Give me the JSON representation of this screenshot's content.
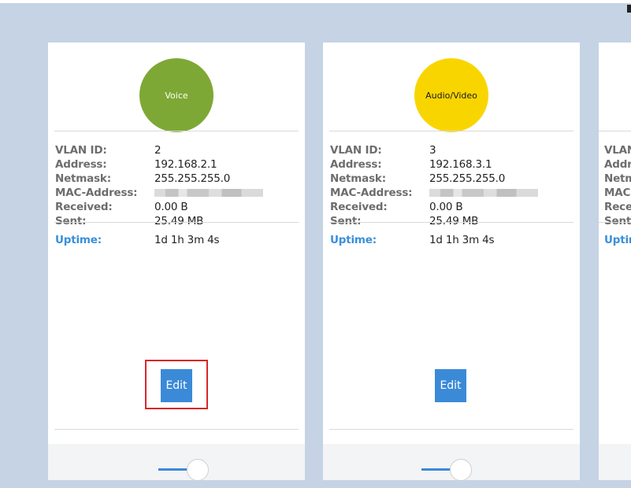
{
  "colors": {
    "voice": "#7ea835",
    "audio_video": "#f9d500",
    "accent": "#3b8ad8",
    "highlight": "#d9262a"
  },
  "labels": {
    "vlan_id": "VLAN ID:",
    "address": "Address:",
    "netmask": "Netmask:",
    "mac": "MAC-Address:",
    "received": "Received:",
    "sent": "Sent:",
    "uptime": "Uptime:"
  },
  "cards": [
    {
      "name": "Voice",
      "vlan_id": "2",
      "address": "192.168.2.1",
      "netmask": "255.255.255.0",
      "received": "0.00 B",
      "sent": "25.49 MB",
      "uptime": "1d 1h 3m 4s",
      "edit_label": "Edit"
    },
    {
      "name": "Audio/Video",
      "vlan_id": "3",
      "address": "192.168.3.1",
      "netmask": "255.255.255.0",
      "received": "0.00 B",
      "sent": "25.49 MB",
      "uptime": "1d 1h 3m 4s",
      "edit_label": "Edit"
    }
  ]
}
